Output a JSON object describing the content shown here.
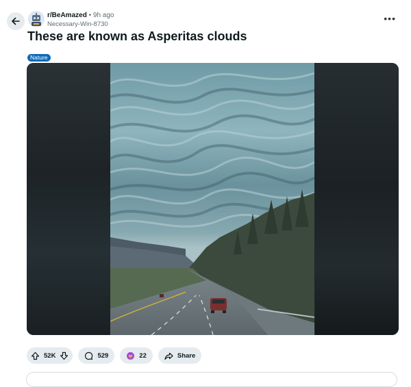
{
  "post": {
    "subreddit": "r/BeAmazed",
    "separator": "•",
    "age": "9h ago",
    "author": "Necessary-Win-8730",
    "title": "These are known as Asperitas clouds",
    "flair": "Nature",
    "flair_color": "#0e6ab8",
    "more_label": "•••"
  },
  "actions": {
    "votes": "52K",
    "comments": "529",
    "awards": "22",
    "share": "Share"
  },
  "icons": {
    "back": "arrow-left-icon",
    "upvote": "arrow-up-icon",
    "downvote": "arrow-down-icon",
    "comment": "speech-bubble-icon",
    "award": "award-icon",
    "share": "share-arrow-icon"
  },
  "colors": {
    "pill_bg": "#e5ebee",
    "text": "#0f1a1c",
    "muted": "#5c6c74"
  }
}
